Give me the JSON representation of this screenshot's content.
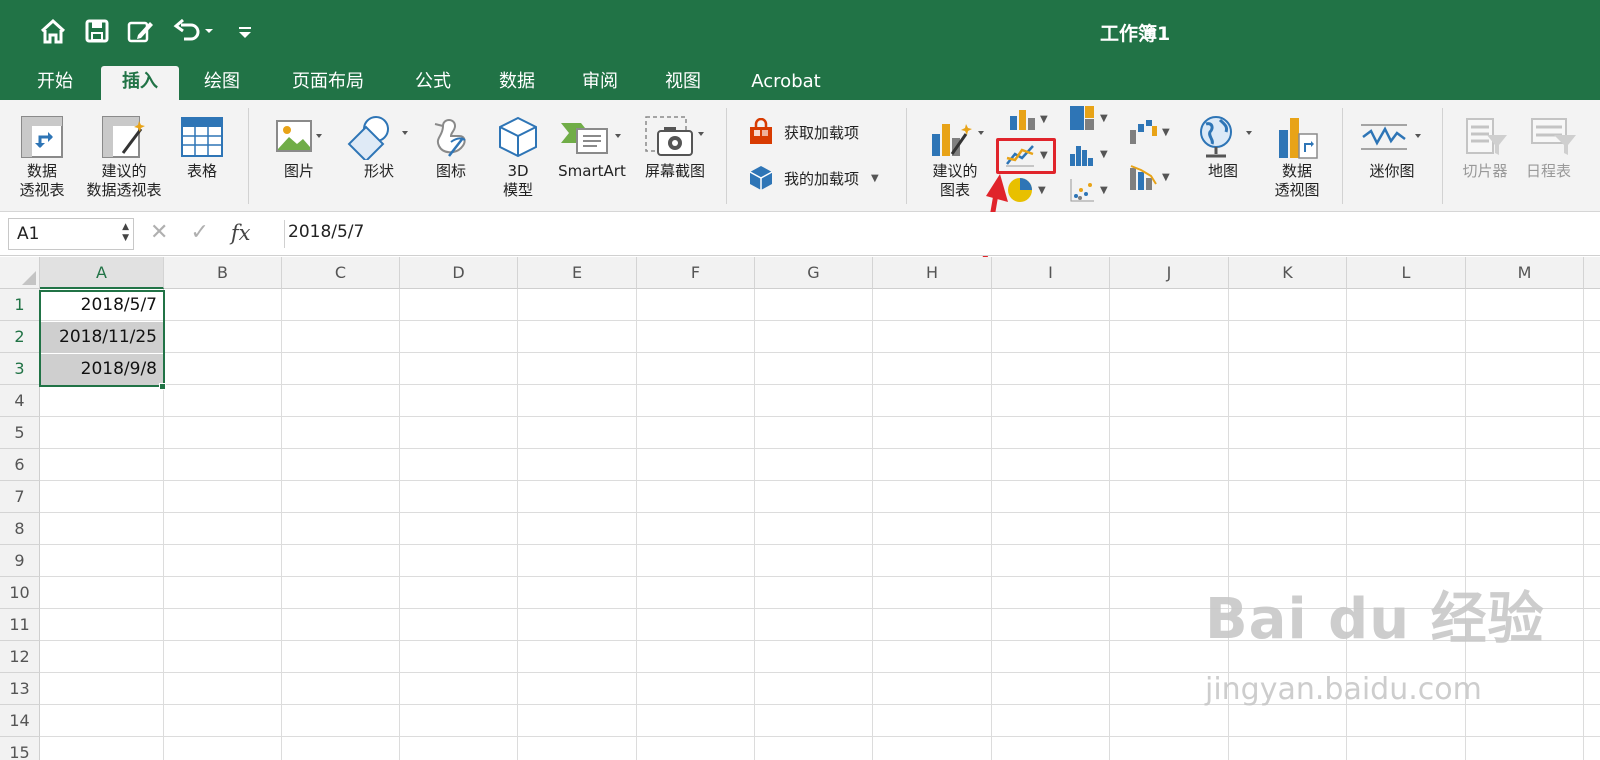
{
  "window": {
    "title": "工作簿1"
  },
  "tabs": [
    {
      "label": "开始",
      "active": false
    },
    {
      "label": "插入",
      "active": true
    },
    {
      "label": "绘图",
      "active": false
    },
    {
      "label": "页面布局",
      "active": false
    },
    {
      "label": "公式",
      "active": false
    },
    {
      "label": "数据",
      "active": false
    },
    {
      "label": "审阅",
      "active": false
    },
    {
      "label": "视图",
      "active": false
    },
    {
      "label": "Acrobat",
      "active": false
    }
  ],
  "ribbon": {
    "pivot_table": {
      "line1": "数据",
      "line2": "透视表"
    },
    "recommended_pivot": {
      "line1": "建议的",
      "line2": "数据透视表"
    },
    "table": "表格",
    "pictures": "图片",
    "shapes": "形状",
    "icons": "图标",
    "model3d": {
      "line1": "3D",
      "line2": "模型"
    },
    "smartart": "SmartArt",
    "screenshot": "屏幕截图",
    "get_addins": "获取加载项",
    "my_addins": "我的加载项",
    "recommended_charts": {
      "line1": "建议的",
      "line2": "图表"
    },
    "map": "地图",
    "pivot_chart": {
      "line1": "数据",
      "line2": "透视图"
    },
    "sparklines": "迷你图",
    "slicer": "切片器",
    "timeline": "日程表"
  },
  "formula_bar": {
    "name_box": "A1",
    "fx": "fx",
    "value": "2018/5/7"
  },
  "sheet": {
    "columns": [
      "A",
      "B",
      "C",
      "D",
      "E",
      "F",
      "G",
      "H",
      "I",
      "J",
      "K",
      "L",
      "M"
    ],
    "rows": [
      "1",
      "2",
      "3",
      "4",
      "5",
      "6",
      "7",
      "8",
      "9",
      "10",
      "11",
      "12",
      "13",
      "14",
      "15"
    ],
    "cells": {
      "A1": "2018/5/7",
      "A2": "2018/11/25",
      "A3": "2018/9/8"
    }
  },
  "watermark": {
    "main": "Bai du 经验",
    "sub": "jingyan.baidu.com"
  },
  "colors": {
    "brand": "#217346",
    "highlight": "#e0242b"
  }
}
